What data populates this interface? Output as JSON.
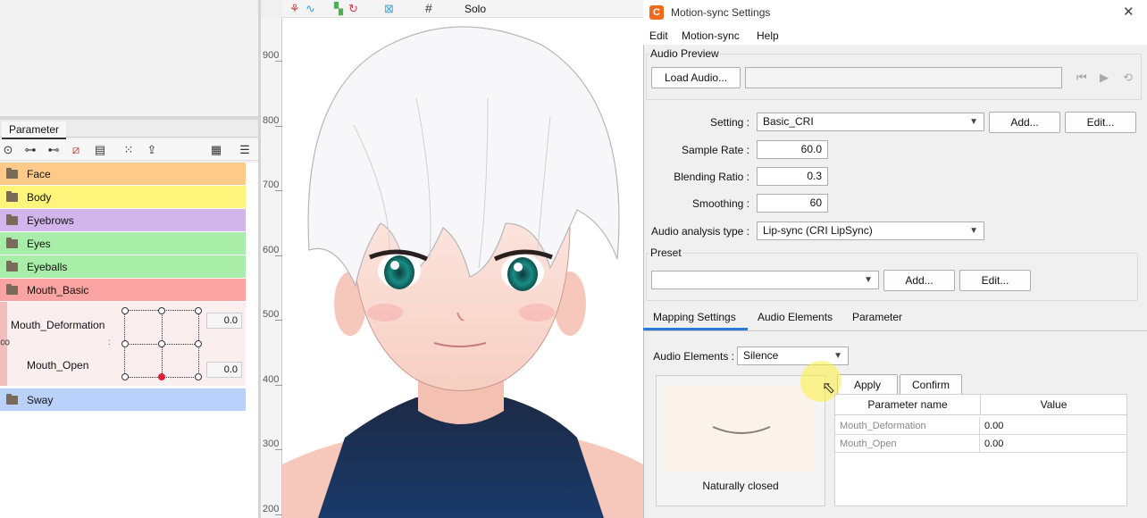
{
  "left_panel": {
    "tab_label": "Parameter",
    "groups": [
      {
        "label": "Face",
        "color": "#ffc98a"
      },
      {
        "label": "Body",
        "color": "#fff57a"
      },
      {
        "label": "Eyebrows",
        "color": "#d2b5ea"
      },
      {
        "label": "Eyes",
        "color": "#a8eea8"
      },
      {
        "label": "Eyeballs",
        "color": "#a8eea8"
      },
      {
        "label": "Mouth_Basic",
        "color": "#f9a3a3"
      },
      {
        "label": "Sway",
        "color": "#b9d1fb"
      }
    ],
    "params": [
      {
        "label": "Mouth_Deformation",
        "value": "0.0"
      },
      {
        "label": "Mouth_Open",
        "value": "0.0"
      }
    ],
    "toolbar_icons": [
      "collapse-icon",
      "link-param-icon",
      "link-key-icon",
      "unlink-icon",
      "display-icon",
      "grid-icon",
      "export-lock-icon",
      "clipboard-icon",
      "menu-icon"
    ]
  },
  "canvas": {
    "toolbar": {
      "solo_label": "Solo"
    },
    "ruler_ticks": [
      "900",
      "800",
      "700",
      "600",
      "500",
      "400",
      "300",
      "200"
    ]
  },
  "dialog": {
    "title": "Motion-sync Settings",
    "menu": [
      "Edit",
      "Motion-sync",
      "Help"
    ],
    "audio_preview": {
      "group_label": "Audio Preview",
      "load_label": "Load Audio...",
      "file_value": ""
    },
    "setting": {
      "label": "Setting :",
      "value": "Basic_CRI",
      "add": "Add...",
      "edit": "Edit..."
    },
    "sample_rate": {
      "label": "Sample Rate :",
      "value": "60.0"
    },
    "blending_ratio": {
      "label": "Blending Ratio :",
      "value": "0.3"
    },
    "smoothing": {
      "label": "Smoothing :",
      "value": "60"
    },
    "audio_analysis": {
      "label": "Audio analysis type :",
      "value": "Lip-sync (CRI LipSync)"
    },
    "preset": {
      "group_label": "Preset",
      "value": "",
      "add": "Add...",
      "edit": "Edit..."
    },
    "tabs": [
      "Mapping Settings",
      "Audio Elements",
      "Parameter"
    ],
    "audio_elements": {
      "label": "Audio Elements :",
      "value": "Silence"
    },
    "preview_caption": "Naturally closed",
    "apply_label": "Apply",
    "confirm_label": "Confirm",
    "table": {
      "headers": [
        "Parameter name",
        "Value"
      ],
      "rows": [
        {
          "name": "Mouth_Deformation",
          "value": "0.00"
        },
        {
          "name": "Mouth_Open",
          "value": "0.00"
        }
      ]
    },
    "accent_color": "#2a7ad6"
  }
}
